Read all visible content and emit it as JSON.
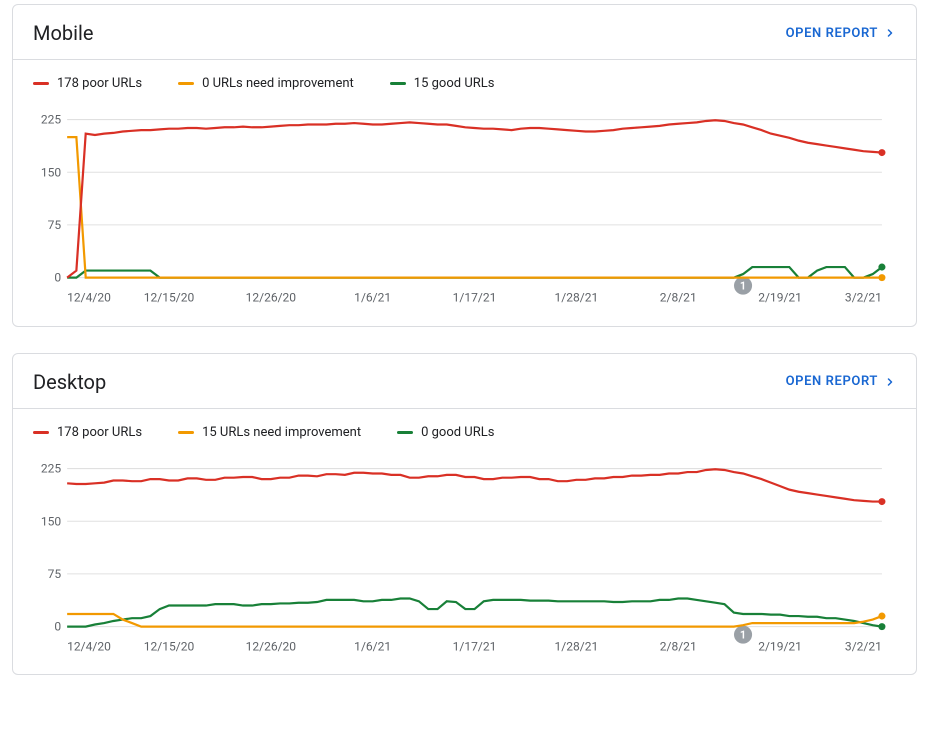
{
  "cards": {
    "mobile": {
      "title": "Mobile",
      "open_report_label": "OPEN REPORT",
      "legend": {
        "poor_label": "178 poor URLs",
        "need_label": "0 URLs need improvement",
        "good_label": "15 good URLs"
      }
    },
    "desktop": {
      "title": "Desktop",
      "open_report_label": "OPEN REPORT",
      "legend": {
        "poor_label": "178 poor URLs",
        "need_label": "15 URLs need improvement",
        "good_label": "0 good URLs"
      }
    }
  },
  "axis": {
    "y_ticks": [
      0,
      75,
      150,
      225
    ],
    "y_max": 240,
    "x_ticks": [
      "12/4/20",
      "12/15/20",
      "12/26/20",
      "1/6/21",
      "1/17/21",
      "1/28/21",
      "2/8/21",
      "2/19/21",
      "3/2/21"
    ],
    "x_count": 89,
    "event_marker": {
      "index": 73,
      "label": "1"
    }
  },
  "chart_data": [
    {
      "id": "mobile",
      "type": "line",
      "title": "Mobile",
      "xlabel": "",
      "ylabel": "",
      "x_ticks": [
        "12/4/20",
        "12/15/20",
        "12/26/20",
        "1/6/21",
        "1/17/21",
        "1/28/21",
        "2/8/21",
        "2/19/21",
        "3/2/21"
      ],
      "ylim": [
        0,
        240
      ],
      "y_ticks": [
        0,
        75,
        150,
        225
      ],
      "legend": [
        "178 poor URLs",
        "0 URLs need improvement",
        "15 good URLs"
      ],
      "event_marker": {
        "index": 73,
        "label": "1"
      },
      "series": [
        {
          "name": "poor",
          "color": "#d93025",
          "values": [
            0,
            10,
            205,
            203,
            205,
            206,
            208,
            209,
            210,
            210,
            211,
            212,
            212,
            213,
            213,
            212,
            213,
            214,
            214,
            215,
            214,
            214,
            215,
            216,
            217,
            217,
            218,
            218,
            218,
            219,
            219,
            220,
            219,
            218,
            218,
            219,
            220,
            221,
            220,
            219,
            218,
            218,
            216,
            214,
            213,
            212,
            212,
            211,
            210,
            212,
            213,
            213,
            212,
            211,
            210,
            209,
            208,
            208,
            209,
            210,
            212,
            213,
            214,
            215,
            216,
            218,
            219,
            220,
            221,
            223,
            224,
            223,
            220,
            218,
            214,
            210,
            205,
            202,
            199,
            195,
            192,
            190,
            188,
            186,
            184,
            182,
            180,
            179,
            178
          ]
        },
        {
          "name": "need",
          "color": "#f29900",
          "values": [
            200,
            200,
            0,
            0,
            0,
            0,
            0,
            0,
            0,
            0,
            0,
            0,
            0,
            0,
            0,
            0,
            0,
            0,
            0,
            0,
            0,
            0,
            0,
            0,
            0,
            0,
            0,
            0,
            0,
            0,
            0,
            0,
            0,
            0,
            0,
            0,
            0,
            0,
            0,
            0,
            0,
            0,
            0,
            0,
            0,
            0,
            0,
            0,
            0,
            0,
            0,
            0,
            0,
            0,
            0,
            0,
            0,
            0,
            0,
            0,
            0,
            0,
            0,
            0,
            0,
            0,
            0,
            0,
            0,
            0,
            0,
            0,
            0,
            0,
            0,
            0,
            0,
            0,
            0,
            0,
            0,
            0,
            0,
            0,
            0,
            0,
            0,
            0,
            0
          ]
        },
        {
          "name": "good",
          "color": "#188038",
          "values": [
            0,
            0,
            10,
            10,
            10,
            10,
            10,
            10,
            10,
            10,
            0,
            0,
            0,
            0,
            0,
            0,
            0,
            0,
            0,
            0,
            0,
            0,
            0,
            0,
            0,
            0,
            0,
            0,
            0,
            0,
            0,
            0,
            0,
            0,
            0,
            0,
            0,
            0,
            0,
            0,
            0,
            0,
            0,
            0,
            0,
            0,
            0,
            0,
            0,
            0,
            0,
            0,
            0,
            0,
            0,
            0,
            0,
            0,
            0,
            0,
            0,
            0,
            0,
            0,
            0,
            0,
            0,
            0,
            0,
            0,
            0,
            0,
            0,
            5,
            15,
            15,
            15,
            15,
            15,
            0,
            0,
            10,
            15,
            15,
            15,
            0,
            0,
            5,
            15
          ]
        }
      ]
    },
    {
      "id": "desktop",
      "type": "line",
      "title": "Desktop",
      "xlabel": "",
      "ylabel": "",
      "x_ticks": [
        "12/4/20",
        "12/15/20",
        "12/26/20",
        "1/6/21",
        "1/17/21",
        "1/28/21",
        "2/8/21",
        "2/19/21",
        "3/2/21"
      ],
      "ylim": [
        0,
        240
      ],
      "y_ticks": [
        0,
        75,
        150,
        225
      ],
      "legend": [
        "178 poor URLs",
        "15 URLs need improvement",
        "0 good URLs"
      ],
      "event_marker": {
        "index": 73,
        "label": "1"
      },
      "series": [
        {
          "name": "poor",
          "color": "#d93025",
          "values": [
            204,
            203,
            203,
            204,
            205,
            208,
            208,
            207,
            207,
            210,
            210,
            208,
            208,
            211,
            211,
            209,
            209,
            212,
            212,
            213,
            213,
            210,
            210,
            212,
            212,
            215,
            215,
            214,
            217,
            217,
            216,
            219,
            219,
            218,
            218,
            216,
            216,
            212,
            212,
            214,
            214,
            216,
            216,
            213,
            213,
            210,
            210,
            212,
            212,
            213,
            213,
            210,
            210,
            207,
            207,
            209,
            209,
            211,
            211,
            213,
            213,
            215,
            215,
            216,
            216,
            218,
            218,
            220,
            220,
            223,
            224,
            223,
            220,
            218,
            214,
            210,
            205,
            200,
            195,
            192,
            190,
            188,
            186,
            184,
            182,
            180,
            179,
            178,
            178
          ]
        },
        {
          "name": "need",
          "color": "#f29900",
          "values": [
            18,
            18,
            18,
            18,
            18,
            18,
            10,
            5,
            0,
            0,
            0,
            0,
            0,
            0,
            0,
            0,
            0,
            0,
            0,
            0,
            0,
            0,
            0,
            0,
            0,
            0,
            0,
            0,
            0,
            0,
            0,
            0,
            0,
            0,
            0,
            0,
            0,
            0,
            0,
            0,
            0,
            0,
            0,
            0,
            0,
            0,
            0,
            0,
            0,
            0,
            0,
            0,
            0,
            0,
            0,
            0,
            0,
            0,
            0,
            0,
            0,
            0,
            0,
            0,
            0,
            0,
            0,
            0,
            0,
            0,
            0,
            0,
            0,
            2,
            5,
            5,
            5,
            5,
            5,
            5,
            5,
            5,
            5,
            5,
            5,
            5,
            7,
            10,
            15
          ]
        },
        {
          "name": "good",
          "color": "#188038",
          "values": [
            0,
            0,
            0,
            3,
            5,
            8,
            10,
            12,
            12,
            15,
            25,
            30,
            30,
            30,
            30,
            30,
            32,
            32,
            32,
            30,
            30,
            32,
            32,
            33,
            33,
            34,
            34,
            35,
            38,
            38,
            38,
            38,
            36,
            36,
            38,
            38,
            40,
            40,
            36,
            25,
            25,
            36,
            35,
            25,
            25,
            36,
            38,
            38,
            38,
            38,
            37,
            37,
            37,
            36,
            36,
            36,
            36,
            36,
            36,
            35,
            35,
            36,
            36,
            36,
            38,
            38,
            40,
            40,
            38,
            36,
            34,
            32,
            20,
            18,
            18,
            18,
            17,
            17,
            15,
            15,
            14,
            14,
            12,
            12,
            10,
            8,
            5,
            2,
            0
          ]
        }
      ]
    }
  ]
}
